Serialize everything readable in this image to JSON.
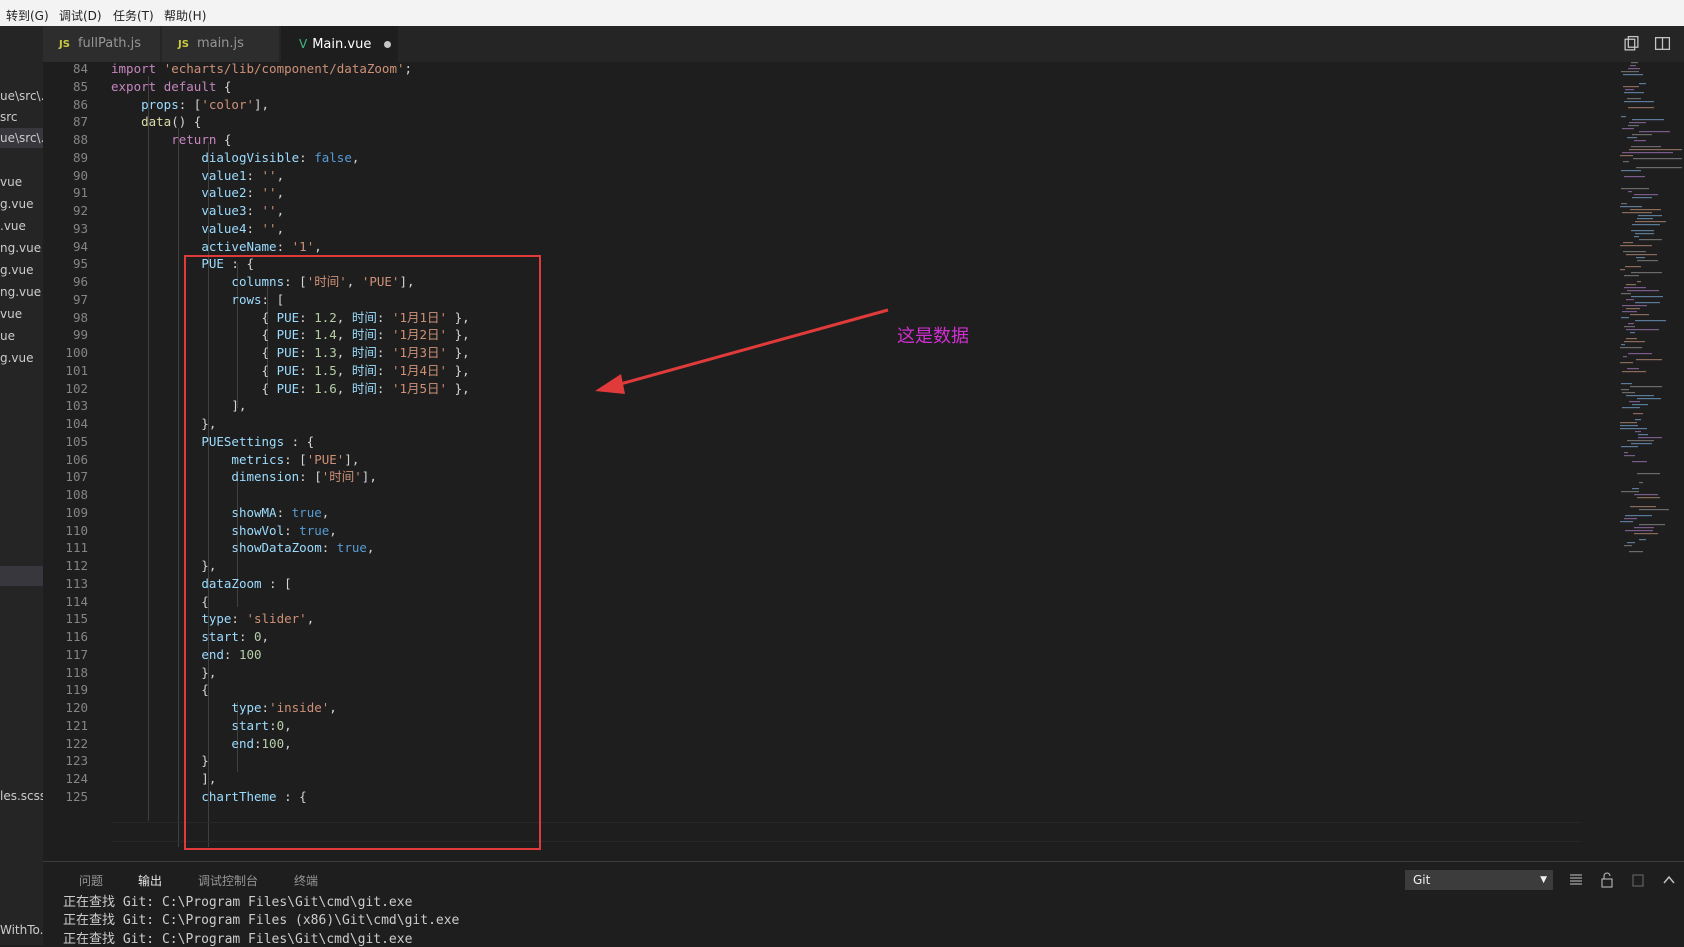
{
  "menu": [
    "转到(G)",
    "调试(D)",
    "任务(T)",
    "帮助(H)"
  ],
  "sidebar_items": [
    "ue\\src\\...",
    "src",
    "ue\\src\\...",
    "vue",
    "g.vue",
    ".vue",
    "ng.vue",
    "g.vue",
    "ng.vue",
    "vue",
    "ue",
    "g.vue",
    "les.scss",
    "WithTo..."
  ],
  "tabs": [
    {
      "label": "fullPath.js",
      "icon": "JS"
    },
    {
      "label": "main.js",
      "icon": "JS"
    },
    {
      "label": "Main.vue",
      "icon": "V"
    }
  ],
  "editor": {
    "lines": [
      {
        "n": "84",
        "code": "import 'echarts/lib/component/dataZoom';"
      },
      {
        "n": "85",
        "code": "export default {"
      },
      {
        "n": "86",
        "code": "    props: ['color'],"
      },
      {
        "n": "87",
        "code": "    data() {"
      },
      {
        "n": "88",
        "code": "        return {"
      },
      {
        "n": "89",
        "code": "            dialogVisible: false,"
      },
      {
        "n": "90",
        "code": "            value1: '',"
      },
      {
        "n": "91",
        "code": "            value2: '',"
      },
      {
        "n": "92",
        "code": "            value3: '',"
      },
      {
        "n": "93",
        "code": "            value4: '',"
      },
      {
        "n": "94",
        "code": "            activeName: '1',"
      },
      {
        "n": "95",
        "code": "            PUE : {"
      },
      {
        "n": "96",
        "code": "                columns: ['时间', 'PUE'],"
      },
      {
        "n": "97",
        "code": "                rows: ["
      },
      {
        "n": "98",
        "code": "                    { PUE: 1.2, 时间: '1月1日' },"
      },
      {
        "n": "99",
        "code": "                    { PUE: 1.4, 时间: '1月2日' },"
      },
      {
        "n": "100",
        "code": "                    { PUE: 1.3, 时间: '1月3日' },"
      },
      {
        "n": "101",
        "code": "                    { PUE: 1.5, 时间: '1月4日' },"
      },
      {
        "n": "102",
        "code": "                    { PUE: 1.6, 时间: '1月5日' },"
      },
      {
        "n": "103",
        "code": "                ],"
      },
      {
        "n": "104",
        "code": "            },"
      },
      {
        "n": "105",
        "code": "            PUESettings : {"
      },
      {
        "n": "106",
        "code": "                metrics: ['PUE'],"
      },
      {
        "n": "107",
        "code": "                dimension: ['时间'],"
      },
      {
        "n": "108",
        "code": ""
      },
      {
        "n": "109",
        "code": "                showMA: true,"
      },
      {
        "n": "110",
        "code": "                showVol: true,"
      },
      {
        "n": "111",
        "code": "                showDataZoom: true,"
      },
      {
        "n": "112",
        "code": "            },"
      },
      {
        "n": "113",
        "code": "            dataZoom : ["
      },
      {
        "n": "114",
        "code": "            {"
      },
      {
        "n": "115",
        "code": "            type: 'slider',"
      },
      {
        "n": "116",
        "code": "            start: 0,"
      },
      {
        "n": "117",
        "code": "            end: 100"
      },
      {
        "n": "118",
        "code": "            },"
      },
      {
        "n": "119",
        "code": "            {"
      },
      {
        "n": "120",
        "code": "                type:'inside',"
      },
      {
        "n": "121",
        "code": "                start:0,"
      },
      {
        "n": "122",
        "code": "                end:100,"
      },
      {
        "n": "123",
        "code": "            }"
      },
      {
        "n": "124",
        "code": "            ],"
      },
      {
        "n": "125",
        "code": "            chartTheme : {"
      }
    ]
  },
  "annotation": "这是数据",
  "panel": {
    "tabs": [
      "问题",
      "输出",
      "调试控制台",
      "终端"
    ],
    "active_tab": "输出",
    "channel": "Git",
    "output": [
      "正在查找 Git: C:\\Program Files\\Git\\cmd\\git.exe",
      "正在查找 Git: C:\\Program Files (x86)\\Git\\cmd\\git.exe",
      "正在查找 Git: C:\\Program Files\\Git\\cmd\\git.exe"
    ]
  },
  "colors": {
    "keyword": "#c586c0",
    "string": "#ce9178",
    "boolean": "#569cd6",
    "number": "#b5cea8",
    "property": "#9cdcfe",
    "annotation": "#d12fd1",
    "box": "#e03a3a"
  }
}
